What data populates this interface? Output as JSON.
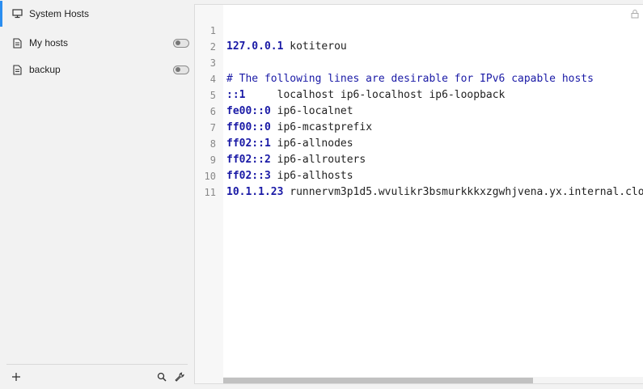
{
  "sidebar": {
    "items": [
      {
        "label": "System Hosts",
        "icon": "monitor-icon",
        "active": true
      },
      {
        "label": "My hosts",
        "icon": "file-icon",
        "enabled": false
      },
      {
        "label": "backup",
        "icon": "file-icon",
        "enabled": false
      }
    ]
  },
  "footer": {
    "icons": [
      "plus-icon",
      "search-icon",
      "wrench-icon"
    ]
  },
  "editor": {
    "readonly_icon": "lock-icon",
    "lines": [
      {
        "num": "1",
        "ip": "127.0.0.1",
        "rest": " kotiterou",
        "comment": ""
      },
      {
        "num": "2",
        "ip": "",
        "rest": "",
        "comment": ""
      },
      {
        "num": "3",
        "ip": "",
        "rest": "",
        "comment": "# The following lines are desirable for IPv6 capable hosts"
      },
      {
        "num": "4",
        "ip": "::1",
        "rest": "     localhost ip6-localhost ip6-loopback",
        "comment": ""
      },
      {
        "num": "5",
        "ip": "fe00::0",
        "rest": " ip6-localnet",
        "comment": ""
      },
      {
        "num": "6",
        "ip": "ff00::0",
        "rest": " ip6-mcastprefix",
        "comment": ""
      },
      {
        "num": "7",
        "ip": "ff02::1",
        "rest": " ip6-allnodes",
        "comment": ""
      },
      {
        "num": "8",
        "ip": "ff02::2",
        "rest": " ip6-allrouters",
        "comment": ""
      },
      {
        "num": "9",
        "ip": "ff02::3",
        "rest": " ip6-allhosts",
        "comment": ""
      },
      {
        "num": "10",
        "ip": "10.1.1.23",
        "rest": " runnervm3p1d5.wvulikr3bsmurkkkxzgwhjvena.yx.internal.clo",
        "comment": ""
      },
      {
        "num": "11",
        "ip": "",
        "rest": "",
        "comment": ""
      }
    ]
  },
  "colors": {
    "accent": "#2b8ef0",
    "ip_text": "#1a1aa6"
  }
}
